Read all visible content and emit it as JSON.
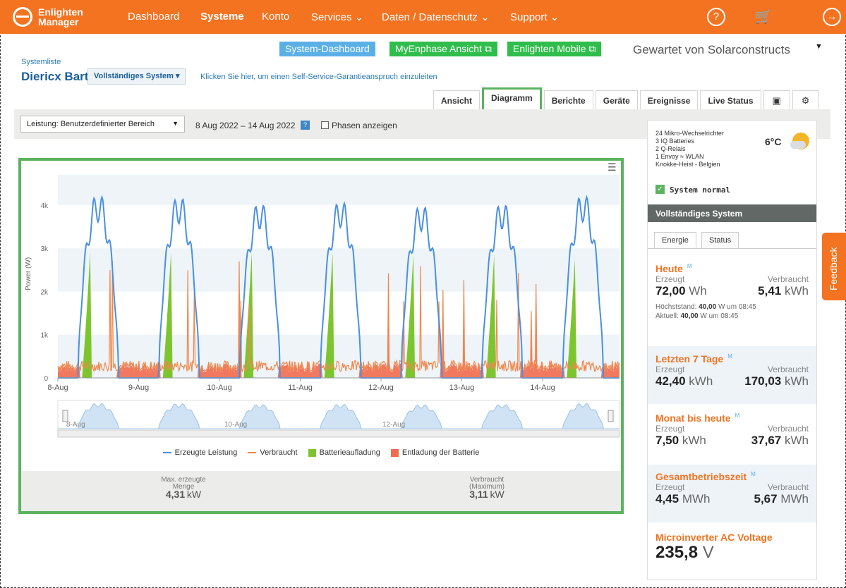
{
  "nav": {
    "logo_line1": "Enlighten",
    "logo_line2": "Manager",
    "items": [
      "Dashboard",
      "Systeme",
      "Konto",
      "Services ⌄",
      "Daten / Datenschutz ⌄",
      "Support ⌄"
    ],
    "active": "Systeme"
  },
  "header": {
    "links": [
      "System-Dashboard",
      "MyEnphase Ansicht ⧉",
      "Enlighten Mobile ⧉"
    ],
    "managed_by": "Gewartet von Solarconstructs",
    "system_list": "Systemliste",
    "system_name": "Diericx Bart",
    "system_dropdown": "Vollständiges System ▾",
    "warranty_link": "Klicken Sie hier, um einen Self-Service-Garantieanspruch einzuleiten"
  },
  "tabs": [
    "Ansicht",
    "Diagramm",
    "Berichte",
    "Geräte",
    "Ereignisse",
    "Live Status"
  ],
  "active_tab": "Diagramm",
  "toolbar": {
    "range_select": "Leistung: Benutzerdefinierter Bereich",
    "dates": "8 Aug 2022 – 14 Aug 2022",
    "help_badge": "?",
    "phases_label": "Phasen anzeigen"
  },
  "chart_data": {
    "type": "area",
    "ylabel": "Power (W)",
    "yticks": [
      "0",
      "1k",
      "2k",
      "3k",
      "4k"
    ],
    "ylim": [
      0,
      4700
    ],
    "categories": [
      "8-Aug",
      "9-Aug",
      "10-Aug",
      "11-Aug",
      "12-Aug",
      "13-Aug",
      "14-Aug"
    ],
    "navigator_labels": [
      "8-Aug",
      "10-Aug",
      "12-Aug"
    ],
    "series": [
      {
        "name": "Erzeugte Leistung",
        "type": "line",
        "color": "#4a90e2",
        "daily_peak_w": [
          4300,
          4250,
          4100,
          4150,
          4050,
          4100,
          4300
        ]
      },
      {
        "name": "Verbraucht",
        "type": "line",
        "color": "#f0884d",
        "typical_w": 300,
        "spike_peak_w": 3100
      },
      {
        "name": "Batterieaufladung",
        "type": "area",
        "color": "#7dc52e",
        "daily_peak_w": [
          2900,
          2900,
          2900,
          2900,
          2850,
          2850,
          2750
        ]
      },
      {
        "name": "Entladung der Batterie",
        "type": "area",
        "color": "#ef6c4f",
        "typical_w": 300
      }
    ],
    "grid": true,
    "legend": "bottom"
  },
  "chart_stats": {
    "max_label": "Max. erzeugte Menge",
    "max_value": "4,31",
    "max_unit": "kW",
    "used_label": "Verbraucht (Maximum)",
    "used_value": "3,11",
    "used_unit": "kW"
  },
  "sidebar": {
    "info": [
      "24 Mikro-Wechselrichter",
      "3 IQ Batteries",
      "2 Q-Relais",
      "1 Envoy ≈ WLAN",
      "Knokke-Heist - Belgien"
    ],
    "temperature": "6°C",
    "status": "System normal",
    "section_title": "Vollständiges System",
    "tabs": [
      "Energie",
      "Status"
    ],
    "today": {
      "title": "Heute",
      "m": "M",
      "produced_label": "Erzeugt",
      "used_label": "Verbraucht",
      "produced": "72,00",
      "produced_unit": "Wh",
      "used": "5,41",
      "used_unit": "kWh",
      "peak_label": "Höchststand:",
      "peak": "40,00",
      "peak_rest": "W um 08:45",
      "current_label": "Aktuell:",
      "current": "40,00",
      "current_rest": "W um 08:45"
    },
    "week": {
      "title": "Letzten 7 Tage",
      "m": "M",
      "produced_label": "Erzeugt",
      "used_label": "Verbraucht",
      "produced": "42,40",
      "produced_unit": "kWh",
      "used": "170,03",
      "used_unit": "kWh"
    },
    "month": {
      "title": "Monat bis heute",
      "m": "M",
      "produced_label": "Erzeugt",
      "used_label": "Verbraucht",
      "produced": "7,50",
      "produced_unit": "kWh",
      "used": "37,67",
      "used_unit": "kWh"
    },
    "lifetime": {
      "title": "Gesamtbetriebszeit",
      "m": "M",
      "produced_label": "Erzeugt",
      "used_label": "Verbraucht",
      "produced": "4,45",
      "produced_unit": "MWh",
      "used": "5,67",
      "used_unit": "MWh"
    },
    "voltage": {
      "title": "Microinverter AC Voltage",
      "value": "235,8",
      "unit": "V"
    }
  },
  "feedback": "Feedback"
}
